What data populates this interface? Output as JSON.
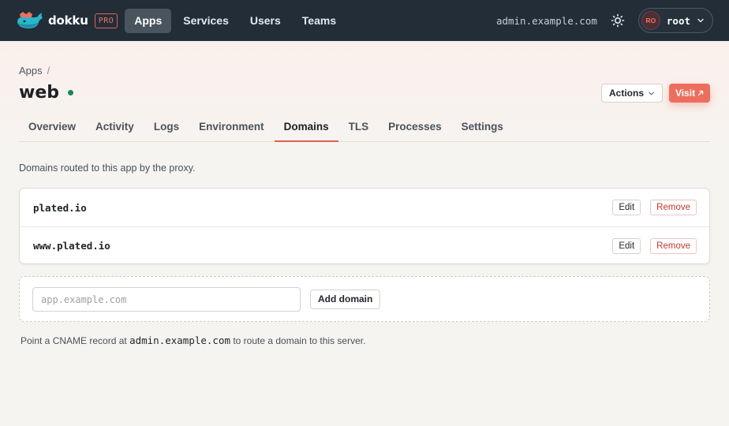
{
  "brand": {
    "name": "dokku",
    "badge": "PRO"
  },
  "nav": {
    "items": [
      {
        "label": "Apps",
        "active": true
      },
      {
        "label": "Services",
        "active": false
      },
      {
        "label": "Users",
        "active": false
      },
      {
        "label": "Teams",
        "active": false
      }
    ]
  },
  "topbar": {
    "host": "admin.example.com",
    "theme_icon": "sun-icon",
    "user": {
      "initials": "RO",
      "name": "root"
    }
  },
  "breadcrumb": {
    "root": "Apps",
    "separator": "/"
  },
  "app": {
    "name": "web",
    "status_color": "#0f8a5f"
  },
  "header_actions": {
    "actions_label": "Actions",
    "visit_label": "Visit"
  },
  "tabs": [
    {
      "label": "Overview",
      "active": false
    },
    {
      "label": "Activity",
      "active": false
    },
    {
      "label": "Logs",
      "active": false
    },
    {
      "label": "Environment",
      "active": false
    },
    {
      "label": "Domains",
      "active": true
    },
    {
      "label": "TLS",
      "active": false
    },
    {
      "label": "Processes",
      "active": false
    },
    {
      "label": "Settings",
      "active": false
    }
  ],
  "domains": {
    "intro": "Domains routed to this app by the proxy.",
    "rows": [
      {
        "name": "plated.io",
        "edit_label": "Edit",
        "remove_label": "Remove"
      },
      {
        "name": "www.plated.io",
        "edit_label": "Edit",
        "remove_label": "Remove"
      }
    ],
    "add": {
      "placeholder": "app.example.com",
      "value": "",
      "button_label": "Add domain"
    },
    "hint": {
      "prefix": "Point a CNAME record at",
      "host": "admin.example.com",
      "suffix": "to route a domain to this server."
    }
  },
  "colors": {
    "accent": "#e0624f",
    "nav_bg": "#222d38",
    "danger": "#c13a2b"
  }
}
